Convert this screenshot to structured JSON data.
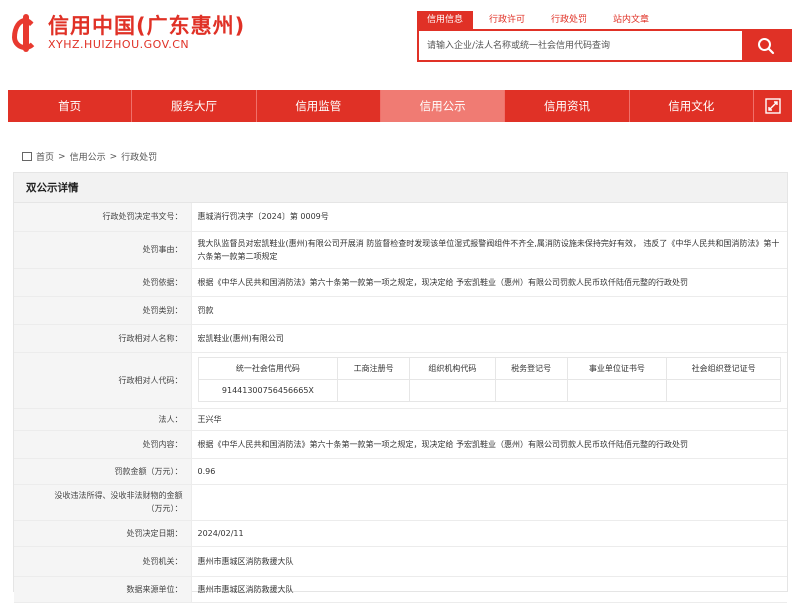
{
  "site": {
    "title": "信用中国(广东惠州)",
    "domain": "XYHZ.HUIZHOU.GOV.CN"
  },
  "search": {
    "tabs": [
      "信用信息",
      "行政许可",
      "行政处罚",
      "站内文章"
    ],
    "placeholder": "请输入企业/法人名称或统一社会信用代码查询"
  },
  "nav": [
    "首页",
    "服务大厅",
    "信用监管",
    "信用公示",
    "信用资讯",
    "信用文化"
  ],
  "breadcrumb": [
    "首页",
    "信用公示",
    "行政处罚"
  ],
  "panel_title": "双公示详情",
  "rows": {
    "doc_no": {
      "label": "行政处罚决定书文号：",
      "value": "惠城消行罚决字〔2024〕第 0009号"
    },
    "reason": {
      "label": "处罚事由：",
      "value": "我大队监督员对宏凯鞋业(惠州)有限公司开展消 防监督检查时发现该单位湿式报警阀组件不齐全,属消防设施未保持完好有效， 违反了《中华人民共和国消防法》第十六条第一款第二项规定"
    },
    "basis": {
      "label": "处罚依据：",
      "value": "根据《中华人民共和国消防法》第六十条第一款第一项之规定，现决定给 予宏凯鞋业（惠州）有限公司罚款人民币玖仟陆佰元整的行政处罚"
    },
    "type": {
      "label": "处罚类别：",
      "value": "罚款"
    },
    "party": {
      "label": "行政相对人名称：",
      "value": "宏凯鞋业(惠州)有限公司"
    },
    "codes_label": "行政相对人代码：",
    "legal": {
      "label": "法人：",
      "value": "王兴华"
    },
    "content": {
      "label": "处罚内容：",
      "value": "根据《中华人民共和国消防法》第六十条第一款第一项之规定，现决定给 予宏凯鞋业（惠州）有限公司罚款人民币玖仟陆佰元整的行政处罚"
    },
    "amount": {
      "label": "罚款金额（万元）：",
      "value": "0.96"
    },
    "confiscate": {
      "label": "没收违法所得、没收非法财物的金额（万元）：",
      "value": ""
    },
    "date": {
      "label": "处罚决定日期：",
      "value": "2024/02/11"
    },
    "organ": {
      "label": "处罚机关：",
      "value": "惠州市惠城区消防救援大队"
    },
    "source": {
      "label": "数据来源单位：",
      "value": "惠州市惠城区消防救援大队"
    }
  },
  "codes": {
    "headers": [
      "统一社会信用代码",
      "工商注册号",
      "组织机构代码",
      "税务登记号",
      "事业单位证书号",
      "社会组织登记证号"
    ],
    "values": [
      "91441300756456665X",
      "",
      "",
      "",
      "",
      ""
    ]
  }
}
